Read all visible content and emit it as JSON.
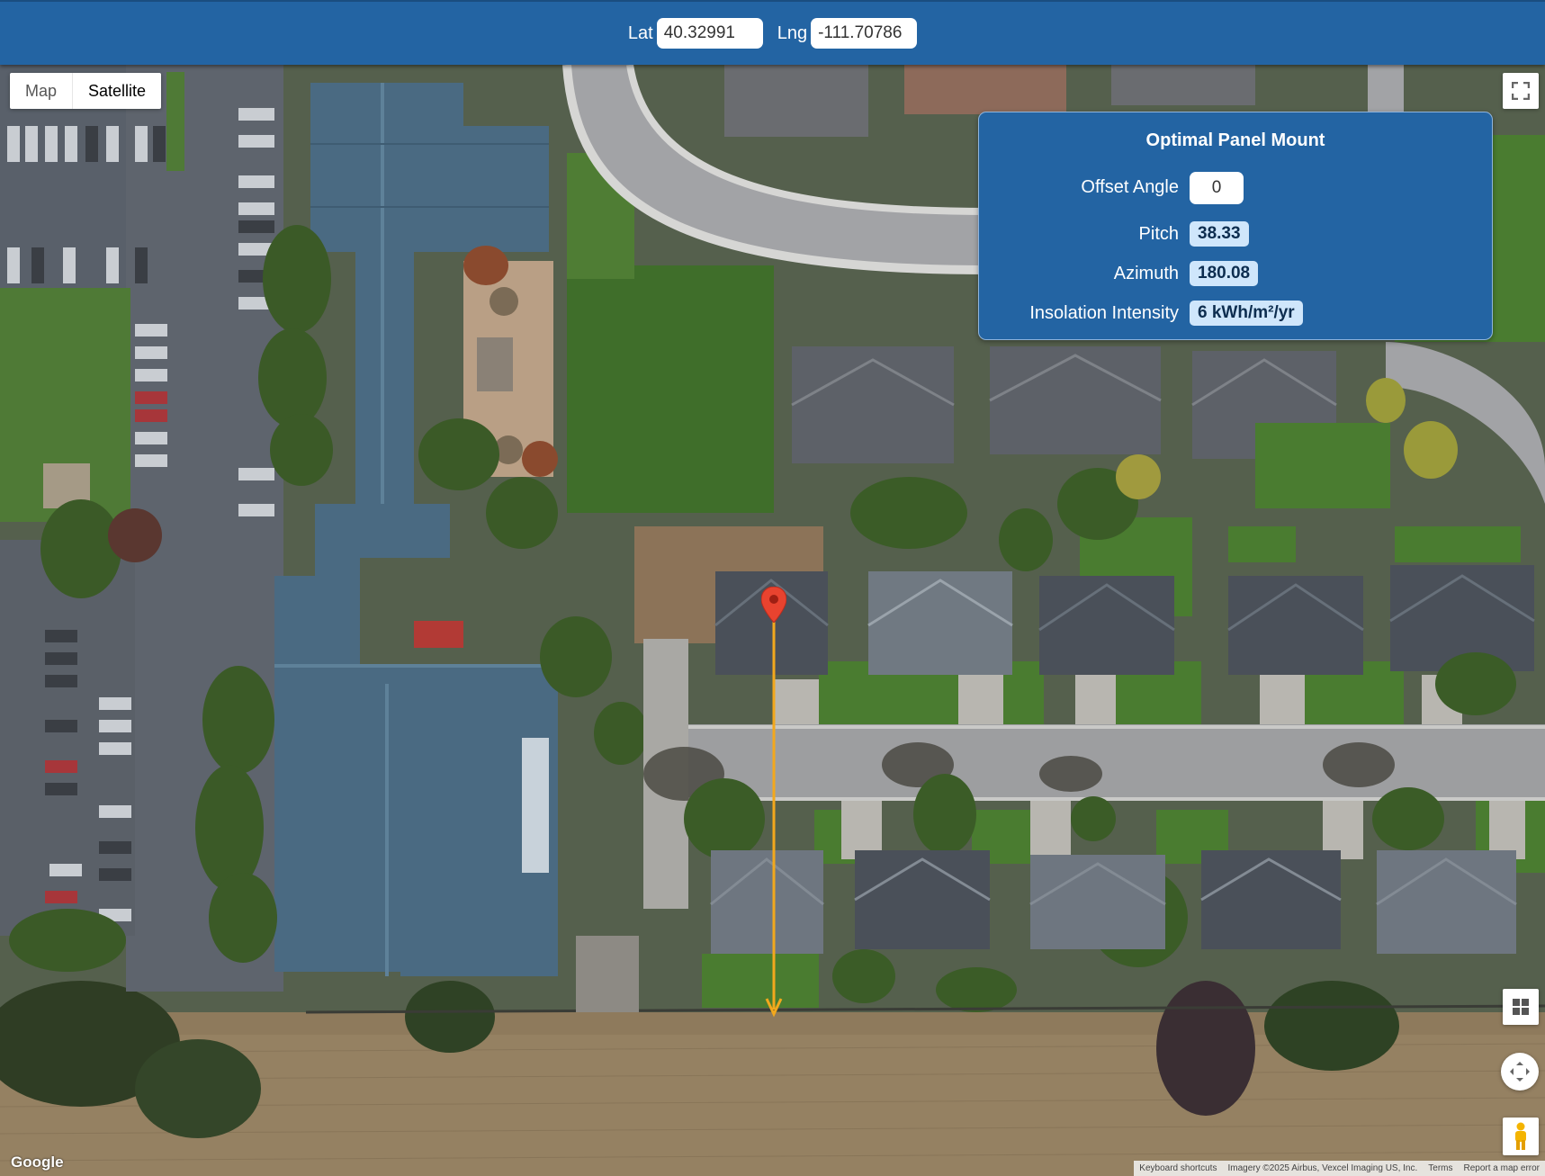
{
  "header": {
    "lat_label": "Lat",
    "lat_value": "40.32991",
    "lng_label": "Lng",
    "lng_value": "-111.70786"
  },
  "map_type": {
    "map_label": "Map",
    "satellite_label": "Satellite",
    "selected": "Satellite"
  },
  "panel": {
    "title": "Optimal Panel Mount",
    "offset_angle_label": "Offset Angle",
    "offset_angle_value": "0",
    "pitch_label": "Pitch",
    "pitch_value": "38.33",
    "azimuth_label": "Azimuth",
    "azimuth_value": "180.08",
    "insolation_label": "Insolation Intensity",
    "insolation_value": "6 kWh/m²/yr"
  },
  "map": {
    "marker_color": "#e8432f",
    "azimuth_line_color": "#f2a81d",
    "accent_color": "#2364a3"
  },
  "footer": {
    "logo": "Google",
    "keyboard_shortcuts": "Keyboard shortcuts",
    "imagery": "Imagery ©2025 Airbus, Vexcel Imaging US, Inc.",
    "terms": "Terms",
    "report": "Report a map error"
  },
  "icons": {
    "fullscreen": "fullscreen-icon",
    "layers": "layers-icon",
    "camera": "camera-control-icon",
    "pegman": "pegman-icon",
    "marker": "map-pin-icon"
  }
}
